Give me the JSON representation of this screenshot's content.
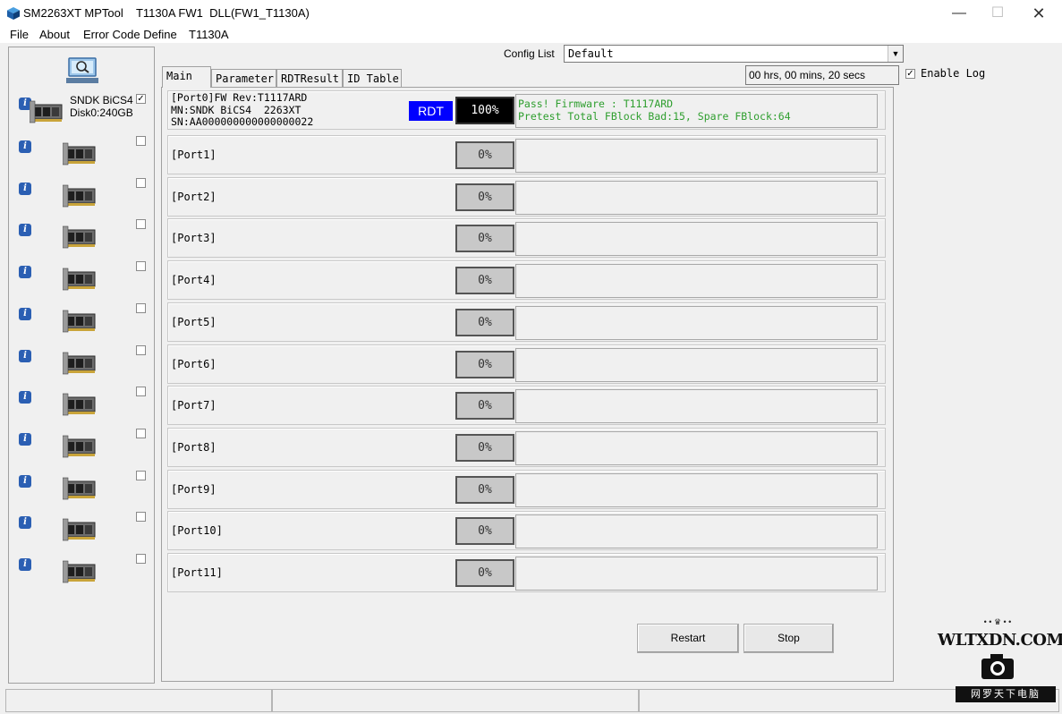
{
  "window": {
    "title": "SM2263XT MPTool    T1130A FW1  DLL(FW1_T1130A)",
    "min_glyph": "—",
    "max_glyph": "☐",
    "close_glyph": "✕"
  },
  "menu": [
    "File",
    "About",
    "Error Code Define",
    "T1130A"
  ],
  "config": {
    "label": "Config List",
    "value": "Default",
    "arrow": "▼"
  },
  "timer": "00 hrs, 00 mins, 20 secs",
  "enable_log": {
    "label": "Enable Log",
    "checked": true
  },
  "tabs": [
    "Main",
    "Parameter",
    "RDTResult",
    "ID Table"
  ],
  "left_panel": {
    "port0_label": "SNDK BiCS4\nDisk0:240GB",
    "icons": {
      "scan": "magnifier-monitor-icon",
      "info": "info-icon",
      "drive": "ssd-board-icon"
    }
  },
  "ports": [
    {
      "label": "",
      "info": "[Port0]FW Rev:T1117ARD\nMN:SNDK BiCS4  2263XT\nSN:AA000000000000000022",
      "badge": "RDT",
      "progress": "100%",
      "status": [
        "Pass! Firmware : T1117ARD",
        "Pretest Total FBlock Bad:15, Spare FBlock:64"
      ],
      "checked": true
    },
    {
      "label": "[Port1]",
      "progress": "0%",
      "checked": false
    },
    {
      "label": "[Port2]",
      "progress": "0%",
      "checked": false
    },
    {
      "label": "[Port3]",
      "progress": "0%",
      "checked": false
    },
    {
      "label": "[Port4]",
      "progress": "0%",
      "checked": false
    },
    {
      "label": "[Port5]",
      "progress": "0%",
      "checked": false
    },
    {
      "label": "[Port6]",
      "progress": "0%",
      "checked": false
    },
    {
      "label": "[Port7]",
      "progress": "0%",
      "checked": false
    },
    {
      "label": "[Port8]",
      "progress": "0%",
      "checked": false
    },
    {
      "label": "[Port9]",
      "progress": "0%",
      "checked": false
    },
    {
      "label": "[Port10]",
      "progress": "0%",
      "checked": false
    },
    {
      "label": "[Port11]",
      "progress": "0%",
      "checked": false
    }
  ],
  "buttons": {
    "restart": "Restart",
    "stop": "Stop"
  },
  "watermark": {
    "crown": "• • ♛ • •",
    "site": "WLTXDN.COM",
    "tagline": "网罗天下电脑"
  },
  "colors": {
    "rdt_badge": "#0000ff",
    "status_text": "#2e9e2e",
    "info_icon": "#2b5fb3"
  }
}
